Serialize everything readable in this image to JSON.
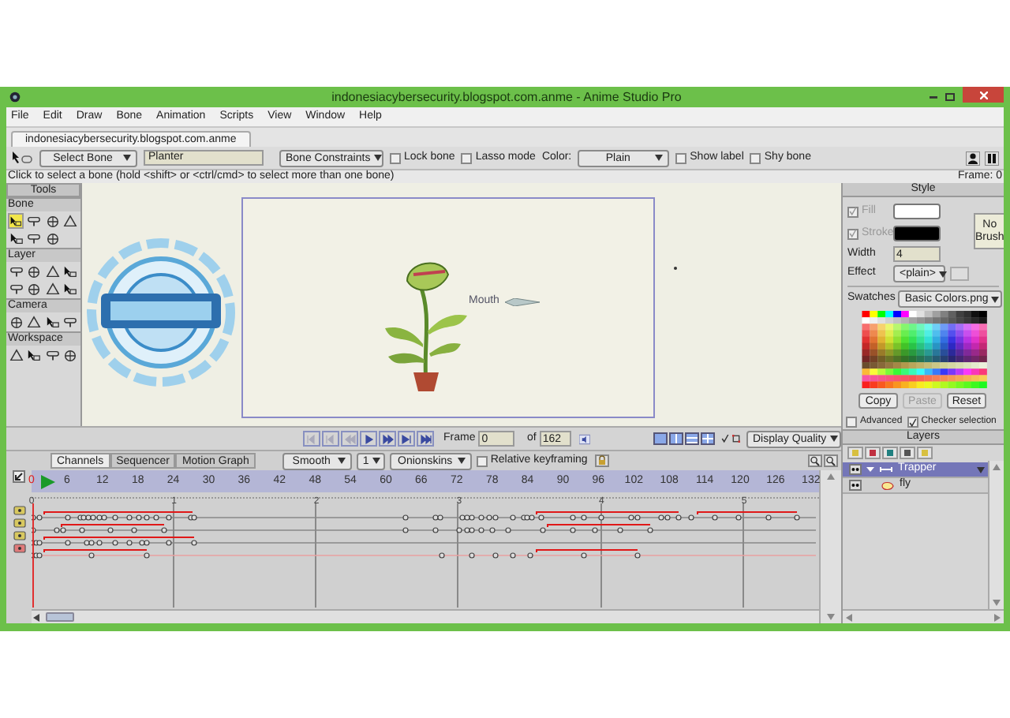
{
  "window": {
    "title": "indonesiacybersecurity.blogspot.com.anme - Anime Studio Pro"
  },
  "menu": [
    "File",
    "Edit",
    "Draw",
    "Bone",
    "Animation",
    "Scripts",
    "View",
    "Window",
    "Help"
  ],
  "document_tabs": [
    {
      "label": "indonesiacybersecurity.blogspot.com.anme",
      "selected": true
    }
  ],
  "toolbar": {
    "tool_dropdown": "Select Bone",
    "bone_name": "Planter",
    "constraints_dropdown": "Bone Constraints",
    "color_label": "Color:",
    "color_dropdown": "Plain",
    "checkboxes_left": [
      {
        "label": "Lock bone",
        "checked": false
      },
      {
        "label": "Lasso mode",
        "checked": false
      }
    ],
    "checkboxes_right": [
      {
        "label": "Show label",
        "checked": false
      },
      {
        "label": "Shy bone",
        "checked": false
      }
    ]
  },
  "status": {
    "hint": "Click to select a bone (hold <shift> or <ctrl/cmd> to select more than one bone)",
    "frame": "Frame: 0"
  },
  "tools": {
    "title": "Tools",
    "groups": [
      {
        "label": "Bone",
        "tools": [
          {
            "selected": true
          },
          {
            "selected": false
          },
          {
            "selected": false
          },
          {
            "selected": false
          },
          {
            "selected": false
          },
          {
            "selected": false
          },
          {
            "selected": false
          }
        ]
      },
      {
        "label": "Layer",
        "tools": [
          {
            "selected": false
          },
          {
            "selected": false
          },
          {
            "selected": false
          },
          {
            "selected": false
          },
          {
            "selected": false
          },
          {
            "selected": false
          },
          {
            "selected": false
          },
          {
            "selected": false
          }
        ]
      },
      {
        "label": "Camera",
        "tools": [
          {
            "selected": false
          },
          {
            "selected": false
          },
          {
            "selected": false
          },
          {
            "selected": false
          }
        ]
      },
      {
        "label": "Workspace",
        "tools": [
          {
            "selected": false
          },
          {
            "selected": false
          },
          {
            "selected": false
          },
          {
            "selected": false
          }
        ]
      }
    ]
  },
  "canvas": {
    "bone_label": "Mouth"
  },
  "playback": {
    "frame_label": "Frame",
    "frame_value": "0",
    "of_label": "of",
    "total_frames": "162",
    "display_quality": "Display Quality"
  },
  "timeline": {
    "tabs": [
      {
        "label": "Channels",
        "selected": true
      },
      {
        "label": "Sequencer",
        "selected": false
      },
      {
        "label": "Motion Graph",
        "selected": false
      }
    ],
    "interpolation": "Smooth",
    "key_step": "1",
    "onionskins": "Onionskins",
    "relative_keyframing": {
      "label": "Relative keyframing",
      "checked": false
    },
    "ruler": [
      "0",
      "6",
      "12",
      "18",
      "24",
      "30",
      "36",
      "42",
      "48",
      "54",
      "60",
      "66",
      "72",
      "78",
      "84",
      "90",
      "96",
      "102",
      "108",
      "114",
      "120",
      "126",
      "132"
    ],
    "seconds": [
      "0",
      "1",
      "2",
      "3",
      "4",
      "5"
    ]
  },
  "style": {
    "title": "Style",
    "colors": [
      {
        "label": "Fill",
        "checked": true,
        "color": "#ffffff"
      },
      {
        "label": "Stroke",
        "checked": true,
        "color": "#000000"
      }
    ],
    "no_brush": "No Brush",
    "width_label": "Width",
    "width_value": "4",
    "effect_label": "Effect",
    "effect_value": "<plain>",
    "swatches_label": "Swatches",
    "swatches_value": "Basic Colors.png",
    "buttons": [
      {
        "label": "Copy",
        "disabled": false
      },
      {
        "label": "Paste",
        "disabled": true
      },
      {
        "label": "Reset",
        "disabled": false
      }
    ],
    "options": [
      {
        "label": "Advanced",
        "checked": false
      },
      {
        "label": "Checker selection",
        "checked": true
      }
    ]
  },
  "layers": {
    "title": "Layers",
    "items": [
      {
        "name": "Trapper",
        "kind": "bone",
        "selected": true,
        "expanded": true,
        "children": [
          {
            "name": "fly",
            "kind": "vector",
            "selected": false
          }
        ]
      }
    ]
  }
}
